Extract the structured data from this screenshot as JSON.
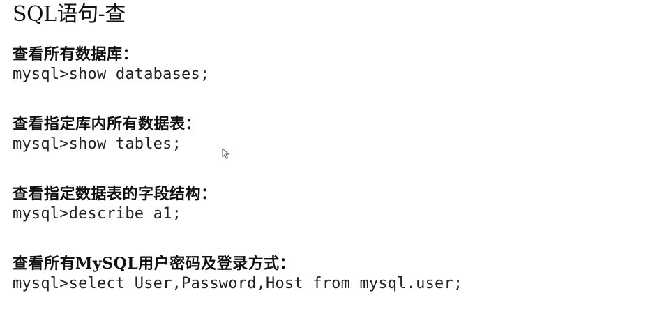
{
  "title": "SQL语句-查",
  "sections": [
    {
      "heading": "查看所有数据库：",
      "command": "mysql>show databases;"
    },
    {
      "heading": "查看指定库内所有数据表：",
      "command": "mysql>show tables;"
    },
    {
      "heading": "查看指定数据表的字段结构：",
      "command": "mysql>describe a1;"
    },
    {
      "heading": "查看所有MySQL用户密码及登录方式：",
      "command": "mysql>select User,Password,Host from mysql.user;"
    }
  ],
  "icons": {
    "cursor": "mouse-pointer-icon"
  }
}
